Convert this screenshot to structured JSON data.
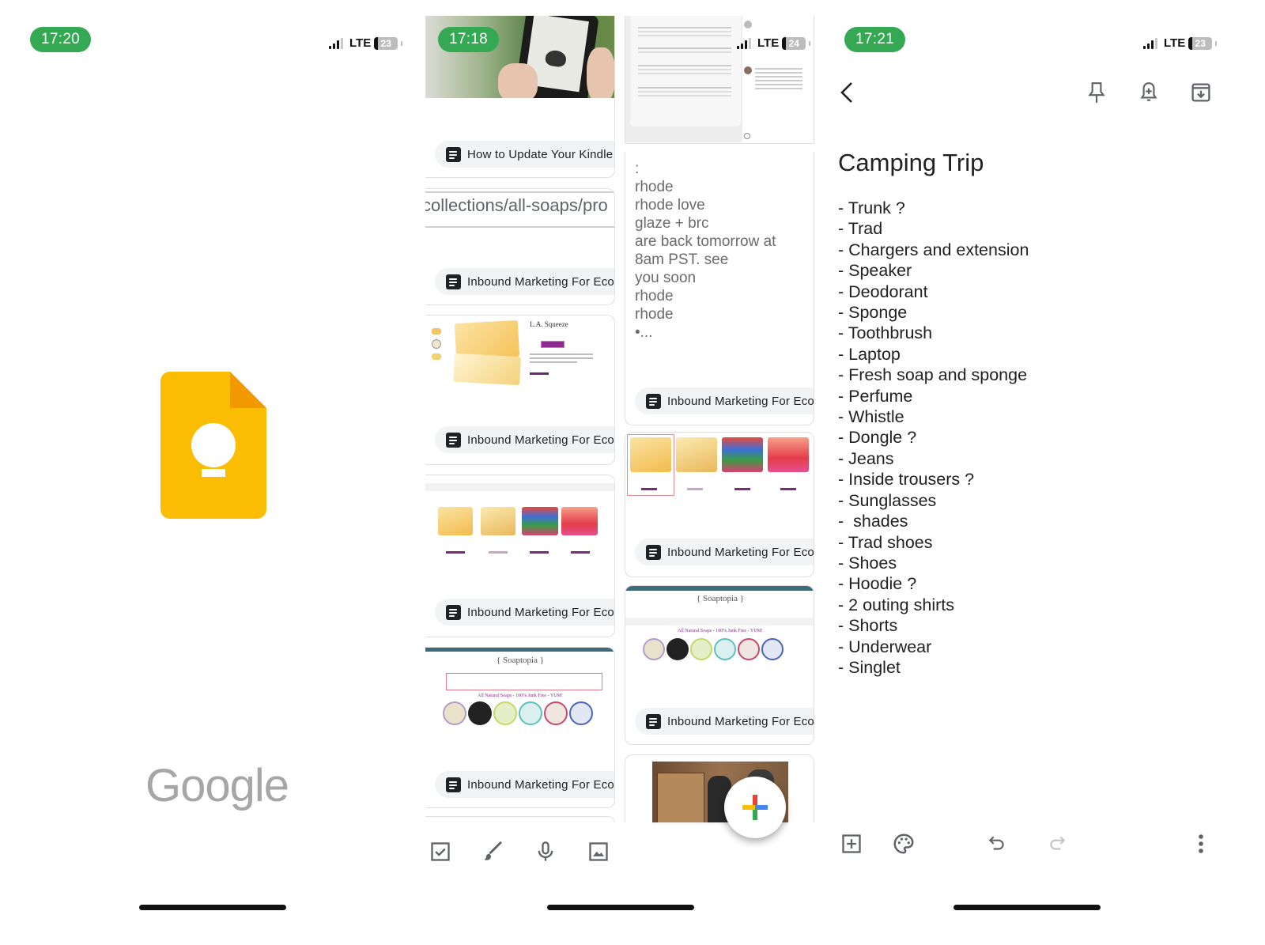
{
  "screens": {
    "splash": {
      "status": {
        "time": "17:20",
        "network": "LTE",
        "battery": "23"
      },
      "app_icon": "google-keep-icon",
      "wordmark": "Google"
    },
    "grid": {
      "status": {
        "time": "17:18",
        "network": "LTE",
        "battery": "24"
      },
      "left_column": [
        {
          "type": "image",
          "image": "kindle-photo",
          "label": "How to Update Your Kindle E"
        },
        {
          "type": "url",
          "text": "collections/all-soaps/pro",
          "label": "Inbound Marketing For Econ"
        },
        {
          "type": "image",
          "image": "la-squeeze-soap-product-page",
          "product_title": "L.A. Squeeze",
          "label": "Inbound Marketing For Econ"
        },
        {
          "type": "image",
          "image": "soap-collection-grid",
          "label": "Inbound Marketing For Econ"
        },
        {
          "type": "image",
          "image": "soaptopia-homepage",
          "site_name": "{ Soaptopia }",
          "banner": "All Natural Soaps - 100% Junk Free - YUM!",
          "label": "Inbound Marketing For Econ"
        }
      ],
      "right_column": [
        {
          "type": "image",
          "image": "instagram-post-screenshot",
          "label": ""
        },
        {
          "type": "text",
          "text": ":\nrhode\nrhode love\nglaze + brc\nare back tomorrow at\n8am PST. see\nyou soon\nrhode\nrhode\n•...",
          "label": "Inbound Marketing For Econ"
        },
        {
          "type": "image",
          "image": "soap-collection-row",
          "label": "Inbound Marketing For Econ"
        },
        {
          "type": "image",
          "image": "soaptopia-homepage",
          "site_name": "{ Soaptopia }",
          "banner": "All Natural Soaps - 100% Junk Free - YUM!",
          "label": "Inbound Marketing For Econ"
        },
        {
          "type": "image",
          "image": "northern-brewer-video",
          "label": ""
        }
      ],
      "bottom_bar": {
        "icons": [
          "checkbox-icon",
          "brush-icon",
          "microphone-icon",
          "image-icon"
        ],
        "fab": "new-note-plus-icon",
        "fab_colors": [
          "#ea4335",
          "#4285f4",
          "#34a853",
          "#fbbc04"
        ]
      }
    },
    "note": {
      "status": {
        "time": "17:21",
        "network": "LTE",
        "battery": "23"
      },
      "toolbar": {
        "back": "back-icon",
        "pin": "pin-icon",
        "reminder": "reminder-bell-icon",
        "archive": "archive-icon"
      },
      "title": "Camping Trip",
      "items": [
        "- Trunk ?",
        "- Trad",
        "- Chargers and extension",
        "- Speaker",
        "- Deodorant",
        "- Sponge",
        "- Toothbrush",
        "- Laptop",
        "- Fresh soap and sponge",
        "- Perfume",
        "- Whistle",
        "- Dongle ?",
        "- Jeans",
        "- Inside trousers ?",
        "- Sunglasses",
        "-  shades",
        "- Trad shoes",
        "- Shoes",
        "- Hoodie ?",
        "- 2 outing shirts",
        "- Shorts",
        "- Underwear",
        "- Singlet"
      ],
      "bottom_toolbar": {
        "add": "add-box-icon",
        "palette": "palette-icon",
        "undo": "undo-icon",
        "redo": "redo-icon",
        "more": "more-vert-icon"
      }
    }
  },
  "colors": {
    "time_pill": "#34a853",
    "keep_yellow": "#fbbc04",
    "keep_fold": "#f29900"
  }
}
